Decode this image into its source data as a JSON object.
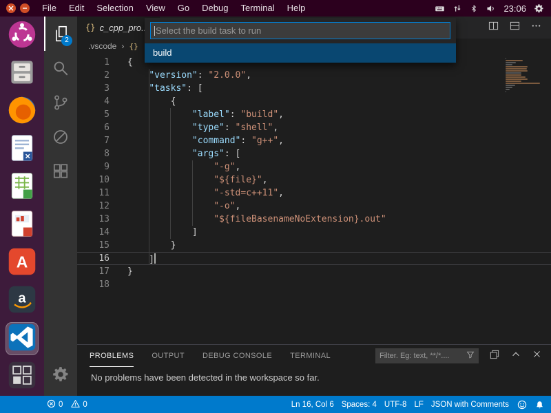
{
  "top_bar": {
    "menus": [
      "File",
      "Edit",
      "Selection",
      "View",
      "Go",
      "Debug",
      "Terminal",
      "Help"
    ],
    "clock": "23:06"
  },
  "dock": {
    "items": [
      {
        "icon": "ubuntu-logo-icon"
      },
      {
        "icon": "file-manager-icon"
      },
      {
        "icon": "firefox-icon"
      },
      {
        "icon": "libreoffice-writer-icon"
      },
      {
        "icon": "libreoffice-calc-icon"
      },
      {
        "icon": "libreoffice-impress-icon"
      },
      {
        "icon": "software-center-icon"
      },
      {
        "icon": "amazon-icon"
      },
      {
        "icon": "vscode-icon",
        "active": true
      },
      {
        "icon": "workspace-switcher-icon"
      }
    ]
  },
  "activity_bar": {
    "items": [
      {
        "icon": "files-icon",
        "badge": "2",
        "active": true
      },
      {
        "icon": "search-icon"
      },
      {
        "icon": "source-control-icon"
      },
      {
        "icon": "debug-icon"
      },
      {
        "icon": "extensions-icon"
      }
    ]
  },
  "editor": {
    "tab": {
      "icon": "{}",
      "label": "c_cpp_pro..."
    },
    "breadcrumb": {
      "folder": ".vscode",
      "separator": "›",
      "file_icon": "{}"
    },
    "quick_pick": {
      "placeholder": "Select the build task to run",
      "items": [
        {
          "label": "build",
          "selected": true
        }
      ]
    },
    "cursor": {
      "line": 16,
      "col": 6
    },
    "lines": [
      [
        [
          "p",
          "{"
        ]
      ],
      [
        [
          "p",
          "    "
        ],
        [
          "k",
          "\"version\""
        ],
        [
          "p",
          ": "
        ],
        [
          "s",
          "\"2.0.0\""
        ],
        [
          "p",
          ","
        ]
      ],
      [
        [
          "p",
          "    "
        ],
        [
          "k",
          "\"tasks\""
        ],
        [
          "p",
          ": ["
        ]
      ],
      [
        [
          "p",
          "        {"
        ]
      ],
      [
        [
          "p",
          "            "
        ],
        [
          "k",
          "\"label\""
        ],
        [
          "p",
          ": "
        ],
        [
          "s",
          "\"build\""
        ],
        [
          "p",
          ","
        ]
      ],
      [
        [
          "p",
          "            "
        ],
        [
          "k",
          "\"type\""
        ],
        [
          "p",
          ": "
        ],
        [
          "s",
          "\"shell\""
        ],
        [
          "p",
          ","
        ]
      ],
      [
        [
          "p",
          "            "
        ],
        [
          "k",
          "\"command\""
        ],
        [
          "p",
          ": "
        ],
        [
          "s",
          "\"g++\""
        ],
        [
          "p",
          ","
        ]
      ],
      [
        [
          "p",
          "            "
        ],
        [
          "k",
          "\"args\""
        ],
        [
          "p",
          ": ["
        ]
      ],
      [
        [
          "p",
          "                "
        ],
        [
          "s",
          "\"-g\""
        ],
        [
          "p",
          ","
        ]
      ],
      [
        [
          "p",
          "                "
        ],
        [
          "s",
          "\"${file}\""
        ],
        [
          "p",
          ","
        ]
      ],
      [
        [
          "p",
          "                "
        ],
        [
          "s",
          "\"-std=c++11\""
        ],
        [
          "p",
          ","
        ]
      ],
      [
        [
          "p",
          "                "
        ],
        [
          "s",
          "\"-o\""
        ],
        [
          "p",
          ","
        ]
      ],
      [
        [
          "p",
          "                "
        ],
        [
          "s",
          "\"${fileBasenameNoExtension}.out\""
        ]
      ],
      [
        [
          "p",
          "            ]"
        ]
      ],
      [
        [
          "p",
          "        }"
        ]
      ],
      [
        [
          "p",
          "    ]"
        ]
      ],
      [
        [
          "p",
          "}"
        ]
      ],
      []
    ]
  },
  "panel": {
    "tabs": [
      {
        "label": "PROBLEMS",
        "active": true
      },
      {
        "label": "OUTPUT"
      },
      {
        "label": "DEBUG CONSOLE"
      },
      {
        "label": "TERMINAL"
      }
    ],
    "filter_placeholder": "Filter. Eg: text, **/*....",
    "message": "No problems have been detected in the workspace so far."
  },
  "status_bar": {
    "left": [
      {
        "icon": "error-icon",
        "value": "0"
      },
      {
        "icon": "warning-icon",
        "value": "0"
      }
    ],
    "right": [
      "Ln 16, Col 6",
      "Spaces: 4",
      "UTF-8",
      "LF",
      "JSON with Comments"
    ]
  },
  "colors": {
    "top_bar": "#2c001e",
    "dock": "#421b40",
    "activity_bar": "#333333",
    "editor_bg": "#1e1e1e",
    "status_bar": "#007acc",
    "list_selection": "#094771",
    "accent": "#007fd4",
    "json_key": "#9cdcfe",
    "json_string": "#ce9178",
    "punctuation": "#d4d4d4"
  }
}
